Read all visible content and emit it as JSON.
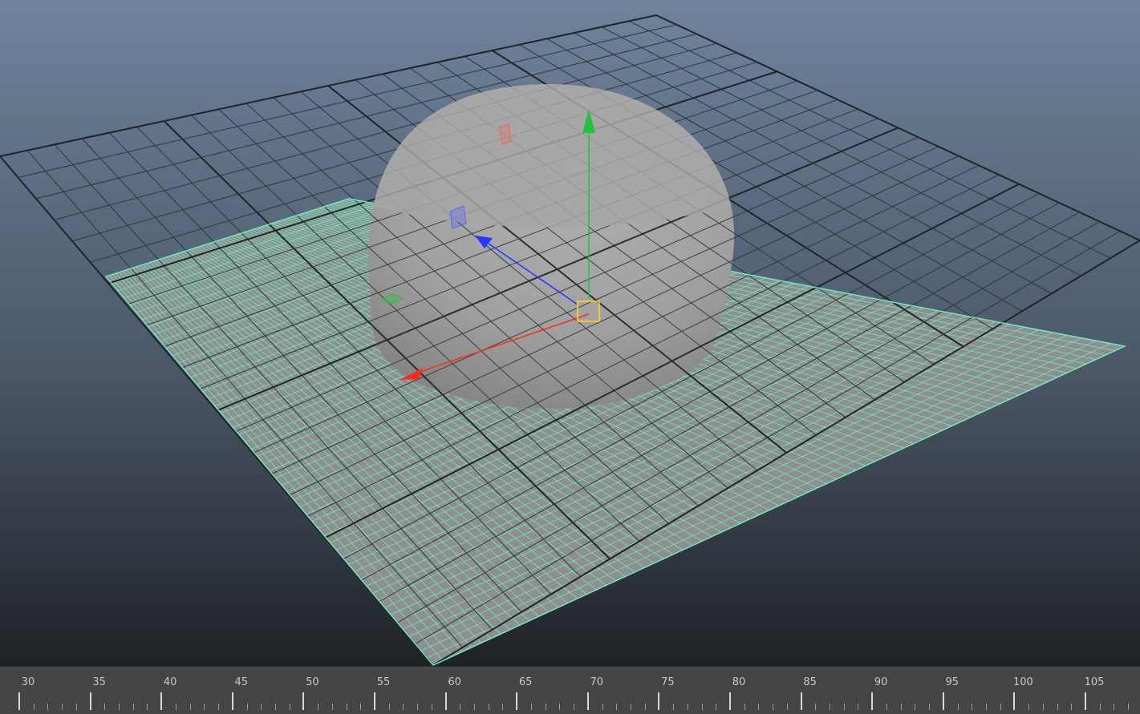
{
  "viewport": {
    "background_top": "#6f839c",
    "background_bottom": "#23262b",
    "plane_color": "#8e8e8e",
    "plane_wire_color": "#6cf0c4",
    "grid_color": "#2b2f35",
    "sphere_color": "#a2a2a2",
    "manipulator": {
      "x_axis_color": "#ff2a1e",
      "y_axis_color": "#22c33a",
      "z_axis_color": "#2a35ff",
      "center_color": "#ffd21c"
    }
  },
  "timeline": {
    "labels": [
      "30",
      "35",
      "40",
      "45",
      "50",
      "55",
      "60",
      "65",
      "70",
      "75",
      "80",
      "85",
      "90",
      "95",
      "100",
      "105"
    ]
  }
}
